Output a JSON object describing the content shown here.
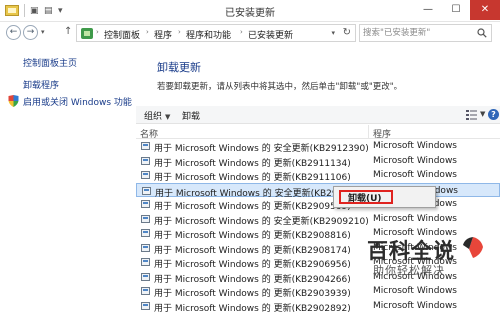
{
  "window": {
    "title": "已安装更新",
    "minimize": "—",
    "maximize": "☐",
    "close": "✕"
  },
  "address": {
    "breadcrumb": [
      "控制面板",
      "程序",
      "程序和功能",
      "已安装更新"
    ],
    "search_placeholder": "搜索\"已安装更新\""
  },
  "sidebar": {
    "home": "控制面板主页",
    "uninstall": "卸载程序",
    "features": "启用或关闭 Windows 功能"
  },
  "main": {
    "title": "卸载更新",
    "description": "若要卸载更新，请从列表中将其选中，然后单击\"卸载\"或\"更改\"。"
  },
  "toolbar": {
    "organize": "组织",
    "uninstall": "卸载"
  },
  "table": {
    "columns": {
      "name": "名称",
      "program": "程序"
    },
    "rows": [
      {
        "name": "用于 Microsoft Windows 的 安全更新(KB2912390)",
        "program": "Microsoft Windows"
      },
      {
        "name": "用于 Microsoft Windows 的 更新(KB2911134)",
        "program": "Microsoft Windows"
      },
      {
        "name": "用于 Microsoft Windows 的 更新(KB2911106)",
        "program": "Microsoft Windows"
      },
      {
        "name": "用于 Microsoft Windows 的 安全更新(KB2909921)",
        "program": "Microsoft Windows",
        "selected": true
      },
      {
        "name": "用于 Microsoft Windows 的 更新(KB2909569)",
        "program": "Microsoft Windows"
      },
      {
        "name": "用于 Microsoft Windows 的 安全更新(KB2909210)",
        "program": "Microsoft Windows"
      },
      {
        "name": "用于 Microsoft Windows 的 更新(KB2908816)",
        "program": "Microsoft Windows"
      },
      {
        "name": "用于 Microsoft Windows 的 更新(KB2908174)",
        "program": "Microsoft Windows"
      },
      {
        "name": "用于 Microsoft Windows 的 更新(KB2906956)",
        "program": "Microsoft Windows"
      },
      {
        "name": "用于 Microsoft Windows 的 更新(KB2904266)",
        "program": "Microsoft Windows"
      },
      {
        "name": "用于 Microsoft Windows 的 更新(KB2903939)",
        "program": "Microsoft Windows"
      },
      {
        "name": "用于 Microsoft Windows 的 更新(KB2902892)",
        "program": "Microsoft Windows"
      }
    ]
  },
  "context_menu": {
    "uninstall": "卸载(U)"
  },
  "watermark": {
    "title": "百科全说",
    "subtitle": "助你轻松解决"
  },
  "colors": {
    "link": "#1a3c8a",
    "selection": "#d7e8fb",
    "highlight_border": "#e0231f",
    "close_button": "#c7372f"
  }
}
